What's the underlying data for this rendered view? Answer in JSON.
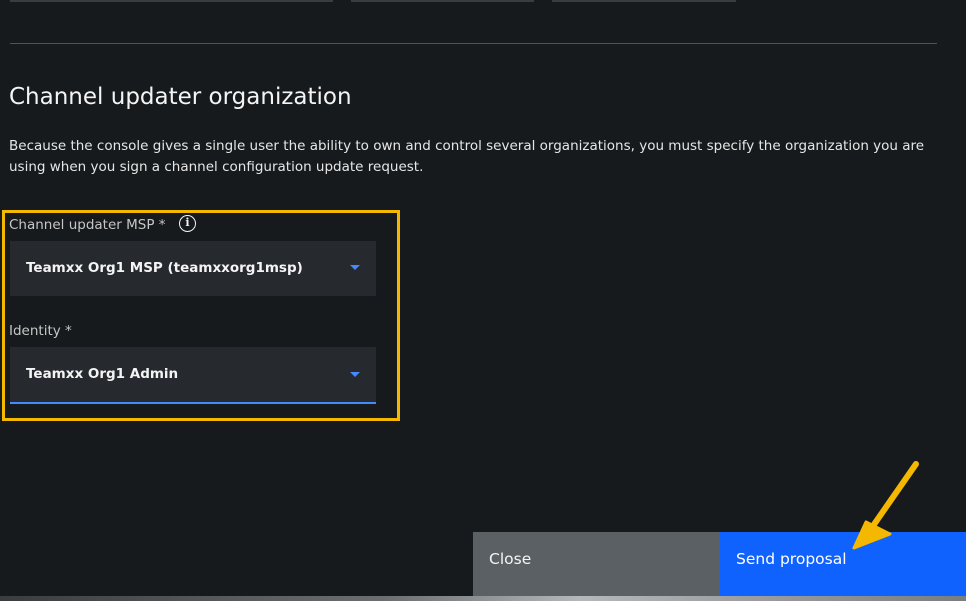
{
  "section": {
    "title": "Channel updater organization",
    "description": "Because the console gives a single user the ability to own and control several organizations, you must specify the organization you are using when you sign a channel configuration update request."
  },
  "fields": {
    "msp": {
      "label": "Channel updater MSP *",
      "info_icon": "i",
      "value": "Teamxx Org1 MSP (teamxxorg1msp)"
    },
    "identity": {
      "label": "Identity *",
      "value": "Teamxx Org1 Admin"
    }
  },
  "actions": {
    "close_label": "Close",
    "send_label": "Send proposal"
  },
  "colors": {
    "background": "#161a1d",
    "highlight": "#f5b800",
    "primary_button": "#0f62fe",
    "secondary_button": "#5b6064",
    "chevron": "#4589ff"
  }
}
